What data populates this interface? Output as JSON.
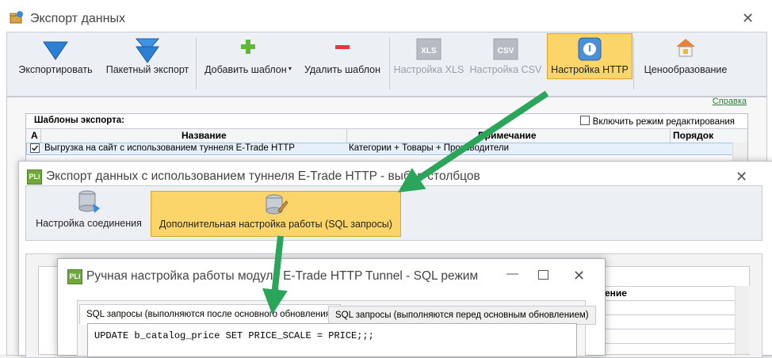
{
  "main_window": {
    "title": "Экспорт данных",
    "toolbar": {
      "export": "Экспортировать",
      "batch_export": "Пакетный экспорт",
      "add_template": "Добавить шаблон",
      "delete_template": "Удалить шаблон",
      "xls_settings": "Настройка XLS",
      "xls_icon_text": "XLS",
      "csv_settings": "Настройка CSV",
      "csv_icon_text": "CSV",
      "http_settings": "Настройка HTTP",
      "pricing": "Ценообразование"
    },
    "help_link": "Справка",
    "templates": {
      "caption": "Шаблоны экспорта:",
      "edit_mode_label": "Включить режим редактирования",
      "columns": [
        "А",
        "Название",
        "Примечание",
        "Порядок"
      ],
      "rows": [
        {
          "checked": true,
          "name": "Выгрузка на сайт с использованием туннеля E-Trade HTTP",
          "note": "Категории + Товары + Производители"
        }
      ]
    }
  },
  "tunnel_window": {
    "title": "Экспорт данных с использованием туннеля E-Trade HTTP - выбор столбцов",
    "icon_text": "PLi",
    "toolbar": {
      "connection_settings": "Настройка соединения",
      "advanced_settings": "Дополнительная настройка работы (SQL запросы)"
    },
    "partial_header": "ение"
  },
  "sql_window": {
    "title": "Ручная настройка работы модуля E-Trade HTTP Tunnel - SQL режим",
    "icon_text": "PLi",
    "tabs": {
      "after": "SQL запросы (выполняются после основного обновления)",
      "before": "SQL запросы (выполняются перед основным обновлением)"
    },
    "sql_text": "UPDATE b_catalog_price SET PRICE_SCALE = PRICE;;;"
  },
  "colors": {
    "selected_fill": "#fbd46a",
    "arrow": "#2aa55a",
    "link": "#2a7d35"
  }
}
